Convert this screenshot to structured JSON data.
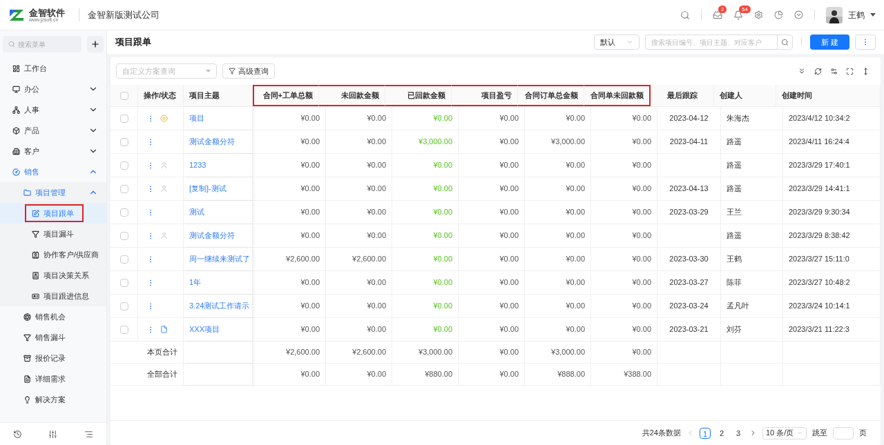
{
  "header": {
    "logo_name": "金智软件",
    "logo_url": "www.jzsoft.cn",
    "company": "金智新版测试公司",
    "badges": [
      {
        "count": "2"
      },
      {
        "count": "54"
      }
    ],
    "user": "王鹤"
  },
  "sidebar": {
    "search_placeholder": "搜索菜单",
    "items": [
      {
        "label": "工作台",
        "selected": false
      },
      {
        "label": "办公",
        "selected": false,
        "expanded": false
      },
      {
        "label": "人事",
        "selected": false,
        "expanded": false
      },
      {
        "label": "产品",
        "selected": false,
        "expanded": false
      },
      {
        "label": "客户",
        "selected": false,
        "expanded": false
      },
      {
        "label": "销售",
        "selected": false,
        "expanded": true,
        "children": [
          {
            "label": "项目管理",
            "selected": false,
            "expanded": true,
            "children": [
              {
                "label": "项目跟单",
                "selected": true,
                "highlighted": true
              },
              {
                "label": "项目漏斗",
                "selected": false,
                "highlighted": false
              },
              {
                "label": "协作客户/供应商",
                "selected": false,
                "highlighted": false
              },
              {
                "label": "项目决策关系",
                "selected": false,
                "highlighted": false
              },
              {
                "label": "项目跟进信息",
                "selected": false,
                "highlighted": false
              }
            ]
          },
          {
            "label": "销售机会",
            "selected": false
          },
          {
            "label": "销售漏斗",
            "selected": false
          },
          {
            "label": "报价记录",
            "selected": false
          },
          {
            "label": "详细需求",
            "selected": false
          },
          {
            "label": "解决方案",
            "selected": false
          }
        ]
      }
    ]
  },
  "page": {
    "title": "项目跟单",
    "view_select": "默认",
    "search_placeholder": "搜索项目编号、项目主题、对应客户",
    "new_button": "新 建"
  },
  "toolbar": {
    "scheme_placeholder": "自定义方案查询",
    "advanced_button": "高级查询"
  },
  "table": {
    "all_checked": false,
    "columns": [
      {
        "label": "操作/状态",
        "highlighted": false
      },
      {
        "label": "项目主题",
        "highlighted": false
      },
      {
        "label": "合同+工单总额",
        "highlighted": true,
        "kind": "amount"
      },
      {
        "label": "未回款金额",
        "highlighted": true,
        "kind": "amount"
      },
      {
        "label": "已回款金额",
        "highlighted": true,
        "kind": "paid"
      },
      {
        "label": "项目盈亏",
        "highlighted": true,
        "kind": "amount"
      },
      {
        "label": "合同订单总金额",
        "highlighted": true,
        "kind": "amount"
      },
      {
        "label": "合同单未回款额",
        "highlighted": true,
        "kind": "amount"
      },
      {
        "label": "最后跟踪",
        "highlighted": false
      },
      {
        "label": "创建人",
        "highlighted": false
      },
      {
        "label": "创建时间",
        "highlighted": false
      }
    ],
    "rows": [
      {
        "checked": false,
        "kind": "play",
        "subject": "项目",
        "values": [
          "¥0.00",
          "¥0.00",
          "¥0.00",
          "¥0.00",
          "¥0.00",
          "¥0.00"
        ],
        "last_follow": "2023-04-12",
        "creator": "朱海杰",
        "created": "2023/4/12 10:34:2"
      },
      {
        "checked": false,
        "subject": "测试金额分符",
        "values": [
          "¥0.00",
          "¥0.00",
          "¥3,000.00",
          "¥0.00",
          "¥3,000.00",
          "¥0.00"
        ],
        "last_follow": "2023-04-11",
        "creator": "路遥",
        "created": "2023/4/11 16:24:4"
      },
      {
        "checked": false,
        "kind": "user",
        "subject": "1233",
        "values": [
          "¥0.00",
          "¥0.00",
          "¥0.00",
          "¥0.00",
          "¥0.00",
          "¥0.00"
        ],
        "creator": "路遥",
        "created": "2023/3/29 17:40:1"
      },
      {
        "checked": false,
        "kind": "user",
        "subject": "[复制]-测试",
        "values": [
          "¥0.00",
          "¥0.00",
          "¥0.00",
          "¥0.00",
          "¥0.00",
          "¥0.00"
        ],
        "last_follow": "2023-04-13",
        "creator": "路遥",
        "created": "2023/3/29 14:41:1"
      },
      {
        "checked": false,
        "subject": "测试",
        "values": [
          "¥0.00",
          "¥0.00",
          "¥0.00",
          "¥0.00",
          "¥0.00",
          "¥0.00"
        ],
        "last_follow": "2023-03-29",
        "creator": "王兰",
        "created": "2023/3/29 9:30:34"
      },
      {
        "checked": false,
        "kind": "user",
        "subject": "测试金额分符",
        "values": [
          "¥0.00",
          "¥0.00",
          "¥0.00",
          "¥0.00",
          "¥0.00",
          "¥0.00"
        ],
        "creator": "路遥",
        "created": "2023/3/29 8:38:42"
      },
      {
        "checked": false,
        "subject": "周一继续来测试了",
        "values": [
          "¥2,600.00",
          "¥2,600.00",
          "¥0.00",
          "¥0.00",
          "¥0.00",
          "¥0.00"
        ],
        "last_follow": "2023-03-30",
        "creator": "王鹤",
        "created": "2023/3/27 15:11:0"
      },
      {
        "checked": false,
        "subject": "1年",
        "values": [
          "¥0.00",
          "¥0.00",
          "¥0.00",
          "¥0.00",
          "¥0.00",
          "¥0.00"
        ],
        "last_follow": "2023-03-27",
        "creator": "陈菲",
        "created": "2023/3/27 10:48:2"
      },
      {
        "checked": false,
        "subject": "3.24测试工作请示",
        "values": [
          "¥0.00",
          "¥0.00",
          "¥0.00",
          "¥0.00",
          "¥0.00",
          "¥0.00"
        ],
        "last_follow": "2023-03-24",
        "creator": "孟凡叶",
        "created": "2023/3/24 10:14:1"
      },
      {
        "checked": false,
        "kind": "doc",
        "subject": "XXX项目",
        "values": [
          "¥0.00",
          "¥0.00",
          "¥0.00",
          "¥0.00",
          "¥0.00",
          "¥0.00"
        ],
        "last_follow": "2023-03-21",
        "creator": "刘芬",
        "created": "2023/3/21 11:22:3"
      }
    ],
    "totals": [
      {
        "label": "本页合计",
        "values": [
          "¥2,600.00",
          "¥2,600.00",
          "¥3,000.00",
          "¥0.00",
          "¥3,000.00",
          "¥0.00"
        ]
      },
      {
        "label": "全部合计",
        "values": [
          "¥0.00",
          "¥0.00",
          "¥880.00",
          "¥0.00",
          "¥888.00",
          "¥388.00"
        ]
      }
    ]
  },
  "pagination": {
    "total": "共24条数据",
    "pages": [
      {
        "label": "1",
        "selected": true
      },
      {
        "label": "2",
        "selected": false
      },
      {
        "label": "3",
        "selected": false
      }
    ],
    "page_size": "10 条/页",
    "jump_label": "跳至",
    "page_unit": "页"
  }
}
